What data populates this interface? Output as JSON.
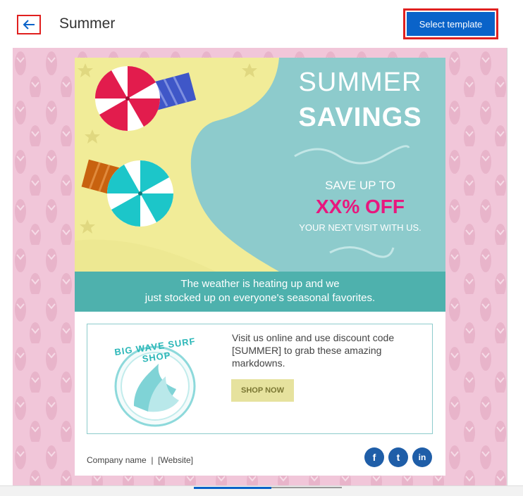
{
  "header": {
    "back_icon": "arrow-left-icon",
    "title": "Summer",
    "select_button": "Select template"
  },
  "email": {
    "headline_line1": "SUMMER",
    "headline_line2": "SAVINGS",
    "save_prefix": "SAVE UP TO",
    "discount": "XX% OFF",
    "save_suffix": "YOUR NEXT VISIT WITH US.",
    "band_line1": "The weather is heating up and we",
    "band_line2": "just stocked up on everyone's seasonal favorites.",
    "logo_text": "BIG WAVE SURF SHOP",
    "promo_text": "Visit us online and use discount code [SUMMER] to grab these amazing markdowns.",
    "shop_button": "SHOP NOW",
    "footer_text": "Company name  |  [Website]",
    "social": {
      "facebook": "f",
      "twitter": "t",
      "linkedin": "in"
    }
  },
  "colors": {
    "accent": "#0a63c9",
    "highlight": "#e0201f",
    "teal": "#8dcbcc",
    "band": "#4eb1ad",
    "pink_background": "#f1c6d9",
    "discount": "#e8177e"
  }
}
